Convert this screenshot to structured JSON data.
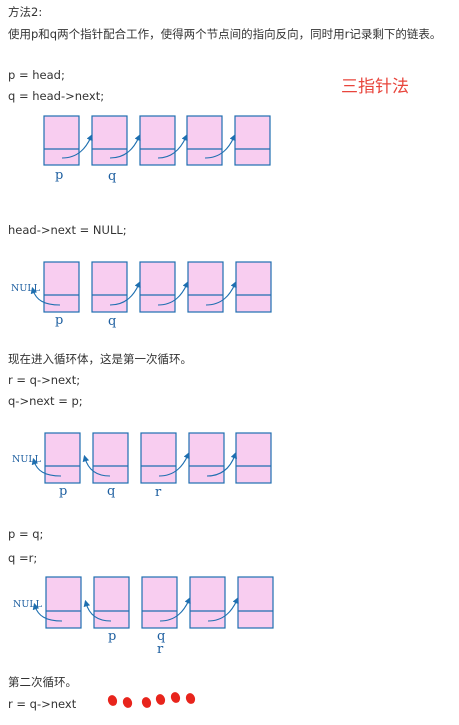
{
  "text": {
    "method": "方法2:",
    "desc": "使用p和q两个指针配合工作，使得两个节点间的指向反向，同时用r记录剩下的链表。",
    "line_p": "p = head;",
    "line_q": "q = head->next;",
    "title_red": "三指针法",
    "line_null": "head->next = NULL;",
    "loop_intro": "现在进入循环体，这是第一次循环。",
    "line_r1": "r = q->next;",
    "line_qnext": "q->next = p;",
    "line_pq": "p = q;",
    "line_qr": "q =r;",
    "second_loop": "第二次循环。",
    "line_r2": "r = q->next"
  },
  "diagrams": {
    "d1": {
      "labels": [
        "p",
        "q"
      ]
    },
    "d2": {
      "null": "NULL",
      "labels": [
        "p",
        "q"
      ]
    },
    "d3": {
      "null": "NULL",
      "labels": [
        "p",
        "q",
        "r"
      ]
    },
    "d4": {
      "null": "NULL",
      "labels": [
        "p",
        "q",
        "r"
      ]
    }
  },
  "colors": {
    "node_fill": "#f8cdf0",
    "node_stroke": "#1e6fb0",
    "label": "#1e5fa0",
    "red_title": "#e8453c"
  }
}
